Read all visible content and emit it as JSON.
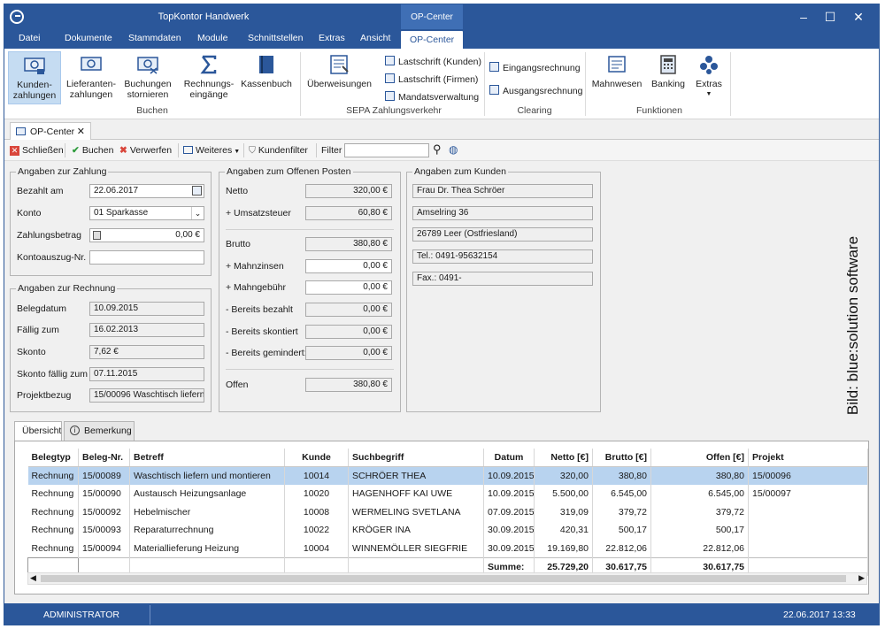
{
  "window": {
    "title": "TopKontor Handwerk",
    "context_title": "OP-Center"
  },
  "tabs": [
    "Datei",
    "Dokumente",
    "Stammdaten",
    "Module",
    "Schnittstellen",
    "Extras",
    "Ansicht",
    "OP-Center"
  ],
  "ribbon": {
    "buchen": {
      "buttons": [
        "Kunden-\nzahlungen",
        "Lieferanten-\nzahlungen",
        "Buchungen\nstornieren",
        "Rechnungs-\neingänge",
        "Kassenbuch"
      ],
      "label": "Buchen"
    },
    "sepa": {
      "big": "Überweisungen",
      "small": [
        "Lastschrift (Kunden)",
        "Lastschrift (Firmen)",
        "Mandatsverwaltung"
      ],
      "label": "SEPA Zahlungsverkehr"
    },
    "clearing": {
      "small": [
        "Eingangsrechnung",
        "Ausgangsrechnung"
      ],
      "label": "Clearing"
    },
    "funktionen": {
      "buttons": [
        "Mahnwesen",
        "Banking",
        "Extras"
      ],
      "label": "Funktionen"
    }
  },
  "doctab": {
    "label": "OP-Center"
  },
  "toolbar": {
    "close": "Schließen",
    "book": "Buchen",
    "discard": "Verwerfen",
    "more": "Weiteres",
    "filter": "Kundenfilter",
    "filter_label": "Filter",
    "filter_value": ""
  },
  "payment": {
    "legend": "Angaben zur Zahlung",
    "paid_on_label": "Bezahlt am",
    "paid_on": "22.06.2017",
    "account_label": "Konto",
    "account": "01 Sparkasse",
    "amount_label": "Zahlungsbetrag",
    "amount": "0,00 €",
    "statement_label": "Kontoauszug-Nr.",
    "statement": ""
  },
  "invoice": {
    "legend": "Angaben zur Rechnung",
    "date_label": "Belegdatum",
    "date": "10.09.2015",
    "due_label": "Fällig zum",
    "due": "16.02.2013",
    "discount_label": "Skonto",
    "discount": "7,62 €",
    "discount_due_label": "Skonto fällig zum",
    "discount_due": "07.11.2015",
    "project_label": "Projektbezug",
    "project": "15/00096 Waschtisch liefern u"
  },
  "open_item": {
    "legend": "Angaben zum Offenen Posten",
    "net_label": "Netto",
    "net": "320,00 €",
    "vat_label": "+ Umsatzsteuer",
    "vat": "60,80 €",
    "gross_label": "Brutto",
    "gross": "380,80 €",
    "dunning_interest_label": "+ Mahnzinsen",
    "dunning_interest": "0,00 €",
    "dunning_fee_label": "+ Mahngebühr",
    "dunning_fee": "0,00 €",
    "paid_label": "- Bereits bezahlt",
    "paid": "0,00 €",
    "discounted_label": "- Bereits skontiert",
    "discounted": "0,00 €",
    "reduced_label": "- Bereits gemindert:",
    "reduced": "0,00 €",
    "open_label": "Offen",
    "open": "380,80 €"
  },
  "customer": {
    "legend": "Angaben zum Kunden",
    "name": "Frau Dr. Thea Schröer",
    "street": "Amselring 36",
    "city": "26789 Leer (Ostfriesland)",
    "phone": "Tel.: 0491-95632154",
    "fax": "Fax.: 0491-"
  },
  "lower_tabs": [
    "Übersicht",
    "Bemerkung"
  ],
  "table": {
    "headers": [
      "Belegtyp",
      "Beleg-Nr.",
      "Betreff",
      "Kunde",
      "Suchbegriff",
      "Datum",
      "Netto [€]",
      "Brutto [€]",
      "Offen [€]",
      "Projekt"
    ],
    "rows": [
      [
        "Rechnung",
        "15/00089",
        "Waschtisch liefern und montieren",
        "10014",
        "SCHRÖER THEA",
        "10.09.2015",
        "320,00",
        "380,80",
        "380,80",
        "15/00096"
      ],
      [
        "Rechnung",
        "15/00090",
        "Austausch Heizungsanlage",
        "10020",
        "HAGENHOFF KAI UWE",
        "10.09.2015",
        "5.500,00",
        "6.545,00",
        "6.545,00",
        "15/00097"
      ],
      [
        "Rechnung",
        "15/00092",
        "Hebelmischer",
        "10008",
        "WERMELING SVETLANA",
        "07.09.2015",
        "319,09",
        "379,72",
        "379,72",
        ""
      ],
      [
        "Rechnung",
        "15/00093",
        "Reparaturrechnung",
        "10022",
        "KRÖGER INA",
        "30.09.2015",
        "420,31",
        "500,17",
        "500,17",
        ""
      ],
      [
        "Rechnung",
        "15/00094",
        "Materiallieferung Heizung",
        "10004",
        "WINNEMÖLLER SIEGFRIE",
        "30.09.2015",
        "19.169,80",
        "22.812,06",
        "22.812,06",
        ""
      ]
    ],
    "sum_label": "Summe:",
    "sum_netto": "25.729,20",
    "sum_brutto": "30.617,75",
    "sum_offen": "30.617,75"
  },
  "status": {
    "user": "ADMINISTRATOR",
    "datetime": "22.06.2017 13:33"
  },
  "credit": "Bild: blue:solution software",
  "colors": {
    "accent": "#2b579a",
    "selection": "#b8d3ef"
  }
}
